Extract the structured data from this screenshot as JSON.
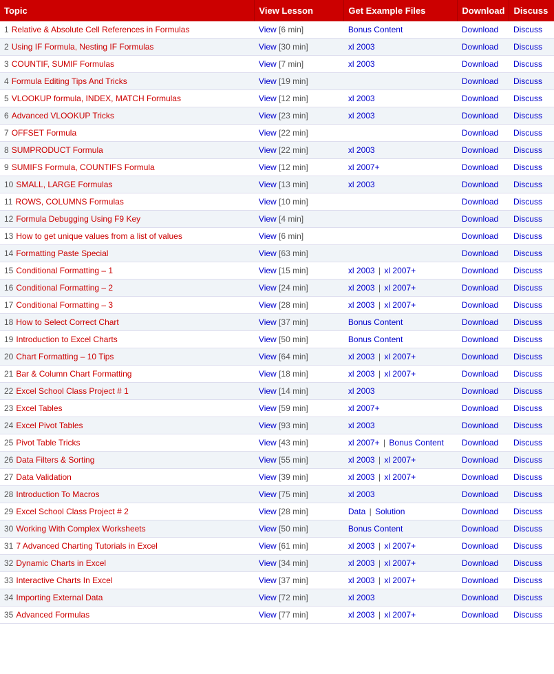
{
  "header": {
    "topic": "Topic",
    "view": "View Lesson",
    "files": "Get Example Files",
    "download": "Download",
    "discuss": "Discuss"
  },
  "rows": [
    {
      "num": 1,
      "topic": "Relative & Absolute Cell References in Formulas",
      "viewTime": "6 min",
      "files": [
        {
          "label": "Bonus Content",
          "type": "bonus"
        }
      ],
      "hasDl": true,
      "hasDisc": true
    },
    {
      "num": 2,
      "topic": "Using IF Formula, Nesting IF Formulas",
      "viewTime": "30 min",
      "files": [
        {
          "label": "xl 2003",
          "type": "file"
        }
      ],
      "hasDl": true,
      "hasDisc": true
    },
    {
      "num": 3,
      "topic": "COUNTIF, SUMIF Formulas",
      "viewTime": "7 min",
      "files": [
        {
          "label": "xl 2003",
          "type": "file"
        }
      ],
      "hasDl": true,
      "hasDisc": true
    },
    {
      "num": 4,
      "topic": "Formula Editing Tips And Tricks",
      "viewTime": "19 min",
      "files": [],
      "hasDl": true,
      "hasDisc": true
    },
    {
      "num": 5,
      "topic": "VLOOKUP formula, INDEX, MATCH Formulas",
      "viewTime": "12 min",
      "files": [
        {
          "label": "xl 2003",
          "type": "file"
        }
      ],
      "hasDl": true,
      "hasDisc": true
    },
    {
      "num": 6,
      "topic": "Advanced VLOOKUP Tricks",
      "viewTime": "23 min",
      "files": [
        {
          "label": "xl 2003",
          "type": "file"
        }
      ],
      "hasDl": true,
      "hasDisc": true
    },
    {
      "num": 7,
      "topic": "OFFSET Formula",
      "viewTime": "22 min",
      "files": [],
      "hasDl": true,
      "hasDisc": true
    },
    {
      "num": 8,
      "topic": "SUMPRODUCT Formula",
      "viewTime": "22 min",
      "files": [
        {
          "label": "xl 2003",
          "type": "file"
        }
      ],
      "hasDl": true,
      "hasDisc": true
    },
    {
      "num": 9,
      "topic": "SUMIFS Formula, COUNTIFS Formula",
      "viewTime": "12 min",
      "files": [
        {
          "label": "xl 2007+",
          "type": "file"
        }
      ],
      "hasDl": true,
      "hasDisc": true
    },
    {
      "num": 10,
      "topic": "SMALL, LARGE Formulas",
      "viewTime": "13 min",
      "files": [
        {
          "label": "xl 2003",
          "type": "file"
        }
      ],
      "hasDl": true,
      "hasDisc": true
    },
    {
      "num": 11,
      "topic": "ROWS, COLUMNS Formulas",
      "viewTime": "10 min",
      "files": [],
      "hasDl": true,
      "hasDisc": true
    },
    {
      "num": 12,
      "topic": "Formula Debugging Using F9 Key",
      "viewTime": "4 min",
      "files": [],
      "hasDl": true,
      "hasDisc": true
    },
    {
      "num": 13,
      "topic": "How to get unique values from a list of values",
      "viewTime": "6 min",
      "files": [],
      "hasDl": true,
      "hasDisc": true
    },
    {
      "num": 14,
      "topic": "Formatting Paste Special",
      "viewTime": "63 min",
      "files": [],
      "hasDl": true,
      "hasDisc": true
    },
    {
      "num": 15,
      "topic": "Conditional Formatting – 1",
      "viewTime": "15 min",
      "files": [
        {
          "label": "xl 2003",
          "type": "file"
        },
        {
          "label": "xl 2007+",
          "type": "file"
        }
      ],
      "hasDl": true,
      "hasDisc": true
    },
    {
      "num": 16,
      "topic": "Conditional Formatting – 2",
      "viewTime": "24 min",
      "files": [
        {
          "label": "xl 2003",
          "type": "file"
        },
        {
          "label": "xl 2007+",
          "type": "file"
        }
      ],
      "hasDl": true,
      "hasDisc": true
    },
    {
      "num": 17,
      "topic": "Conditional Formatting – 3",
      "viewTime": "28 min",
      "files": [
        {
          "label": "xl 2003",
          "type": "file"
        },
        {
          "label": "xl 2007+",
          "type": "file"
        }
      ],
      "hasDl": true,
      "hasDisc": true
    },
    {
      "num": 18,
      "topic": "How to Select Correct Chart",
      "viewTime": "37 min",
      "files": [
        {
          "label": "Bonus Content",
          "type": "bonus"
        }
      ],
      "hasDl": true,
      "hasDisc": true
    },
    {
      "num": 19,
      "topic": "Introduction to Excel Charts",
      "viewTime": "50 min",
      "files": [
        {
          "label": "Bonus Content",
          "type": "bonus"
        }
      ],
      "hasDl": true,
      "hasDisc": true
    },
    {
      "num": 20,
      "topic": "Chart Formatting – 10 Tips",
      "viewTime": "64 min",
      "files": [
        {
          "label": "xl 2003",
          "type": "file"
        },
        {
          "label": "xl 2007+",
          "type": "file"
        }
      ],
      "hasDl": true,
      "hasDisc": true
    },
    {
      "num": 21,
      "topic": "Bar & Column Chart Formatting",
      "viewTime": "18 min",
      "files": [
        {
          "label": "xl 2003",
          "type": "file"
        },
        {
          "label": "xl 2007+",
          "type": "file"
        }
      ],
      "hasDl": true,
      "hasDisc": true
    },
    {
      "num": 22,
      "topic": "Excel School Class Project # 1",
      "viewTime": "14 min",
      "files": [
        {
          "label": "xl 2003",
          "type": "file"
        }
      ],
      "hasDl": true,
      "hasDisc": true
    },
    {
      "num": 23,
      "topic": "Excel Tables",
      "viewTime": "59 min",
      "files": [
        {
          "label": "xl 2007+",
          "type": "file"
        }
      ],
      "hasDl": true,
      "hasDisc": true
    },
    {
      "num": 24,
      "topic": "Excel Pivot Tables",
      "viewTime": "93 min",
      "files": [
        {
          "label": "xl 2003",
          "type": "file"
        }
      ],
      "hasDl": true,
      "hasDisc": true
    },
    {
      "num": 25,
      "topic": "Pivot Table Tricks",
      "viewTime": "43 min",
      "files": [
        {
          "label": "xl 2007+",
          "type": "file"
        },
        {
          "label": "Bonus Content",
          "type": "bonus"
        }
      ],
      "hasDl": true,
      "hasDisc": true
    },
    {
      "num": 26,
      "topic": "Data Filters & Sorting",
      "viewTime": "55 min",
      "files": [
        {
          "label": "xl 2003",
          "type": "file"
        },
        {
          "label": "xl 2007+",
          "type": "file"
        }
      ],
      "hasDl": true,
      "hasDisc": true
    },
    {
      "num": 27,
      "topic": "Data Validation",
      "viewTime": "39 min",
      "files": [
        {
          "label": "xl 2003",
          "type": "file"
        },
        {
          "label": "xl 2007+",
          "type": "file"
        }
      ],
      "hasDl": true,
      "hasDisc": true
    },
    {
      "num": 28,
      "topic": "Introduction To Macros",
      "viewTime": "75 min",
      "files": [
        {
          "label": "xl 2003",
          "type": "file"
        }
      ],
      "hasDl": true,
      "hasDisc": true
    },
    {
      "num": 29,
      "topic": "Excel School Class Project # 2",
      "viewTime": "28 min",
      "files": [
        {
          "label": "Data",
          "type": "file"
        },
        {
          "label": "Solution",
          "type": "file"
        }
      ],
      "hasDl": true,
      "hasDisc": true
    },
    {
      "num": 30,
      "topic": "Working With Complex Worksheets",
      "viewTime": "50 min",
      "files": [
        {
          "label": "Bonus Content",
          "type": "bonus"
        }
      ],
      "hasDl": true,
      "hasDisc": true
    },
    {
      "num": 31,
      "topic": "7 Advanced Charting Tutorials in Excel",
      "viewTime": "61 min",
      "files": [
        {
          "label": "xl 2003",
          "type": "file"
        },
        {
          "label": "xl 2007+",
          "type": "file"
        }
      ],
      "hasDl": true,
      "hasDisc": true
    },
    {
      "num": 32,
      "topic": "Dynamic Charts in Excel",
      "viewTime": "34 min",
      "files": [
        {
          "label": "xl 2003",
          "type": "file"
        },
        {
          "label": "xl 2007+",
          "type": "file"
        }
      ],
      "hasDl": true,
      "hasDisc": true
    },
    {
      "num": 33,
      "topic": "Interactive Charts In Excel",
      "viewTime": "37 min",
      "files": [
        {
          "label": "xl 2003",
          "type": "file"
        },
        {
          "label": "xl 2007+",
          "type": "file"
        }
      ],
      "hasDl": true,
      "hasDisc": true
    },
    {
      "num": 34,
      "topic": "Importing External Data",
      "viewTime": "72 min",
      "files": [
        {
          "label": "xl 2003",
          "type": "file"
        }
      ],
      "hasDl": true,
      "hasDisc": true
    },
    {
      "num": 35,
      "topic": "Advanced Formulas",
      "viewTime": "77 min",
      "files": [
        {
          "label": "xl 2003",
          "type": "file"
        },
        {
          "label": "xl 2007+",
          "type": "file"
        }
      ],
      "hasDl": true,
      "hasDisc": true
    }
  ],
  "labels": {
    "download": "Download",
    "discuss": "Discuss",
    "view": "View",
    "separator": "|"
  }
}
